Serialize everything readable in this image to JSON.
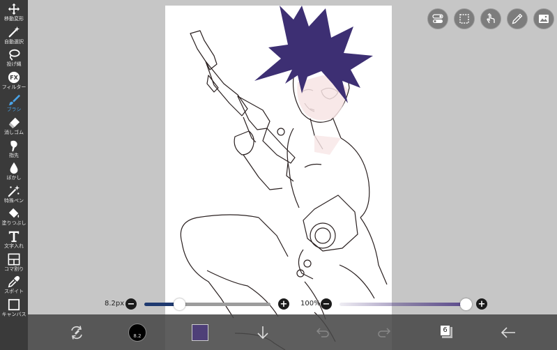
{
  "tools": [
    {
      "id": "move",
      "label": "移動変形",
      "icon": "move-arrows-icon",
      "active": false
    },
    {
      "id": "auto-select",
      "label": "自動選択",
      "icon": "magic-wand-icon",
      "active": false
    },
    {
      "id": "lasso",
      "label": "投げ縄",
      "icon": "lasso-icon",
      "active": false
    },
    {
      "id": "filter",
      "label": "フィルター",
      "icon": "fx-icon",
      "active": false
    },
    {
      "id": "brush",
      "label": "ブラシ",
      "icon": "brush-icon",
      "active": true
    },
    {
      "id": "eraser",
      "label": "消しゴム",
      "icon": "eraser-icon",
      "active": false
    },
    {
      "id": "smudge",
      "label": "指先",
      "icon": "finger-icon",
      "active": false
    },
    {
      "id": "blur",
      "label": "ぼかし",
      "icon": "droplet-icon",
      "active": false
    },
    {
      "id": "special-pen",
      "label": "特殊ペン",
      "icon": "sparkle-pen-icon",
      "active": false
    },
    {
      "id": "fill",
      "label": "塗りつぶし",
      "icon": "bucket-icon",
      "active": false
    },
    {
      "id": "text",
      "label": "文字入れ",
      "icon": "text-t-icon",
      "active": false
    },
    {
      "id": "frame",
      "label": "コマ割り",
      "icon": "frame-split-icon",
      "active": false
    },
    {
      "id": "eyedropper",
      "label": "スポイト",
      "icon": "eyedropper-icon",
      "active": false
    },
    {
      "id": "canvas",
      "label": "キャンバス",
      "icon": "canvas-icon",
      "active": false
    }
  ],
  "top_buttons": [
    {
      "id": "toggle",
      "icon": "toggle-switch-icon"
    },
    {
      "id": "selection",
      "icon": "dashed-selection-icon"
    },
    {
      "id": "touch",
      "icon": "touch-hand-icon"
    },
    {
      "id": "pen",
      "icon": "pen-icon"
    },
    {
      "id": "image",
      "icon": "image-layer-icon"
    }
  ],
  "brush_size": {
    "label": "8.2px",
    "value": 8.2,
    "fraction": 0.28
  },
  "opacity": {
    "label": "100%",
    "value": 100,
    "fraction": 1.0
  },
  "bottom": {
    "brush_size_badge": "8.2",
    "layer_count": "6",
    "current_color": "#4e3f78"
  },
  "colors": {
    "accent": "#4aa3e6",
    "hair": "#3d2f73",
    "slider_fill": "#1f3a70"
  }
}
